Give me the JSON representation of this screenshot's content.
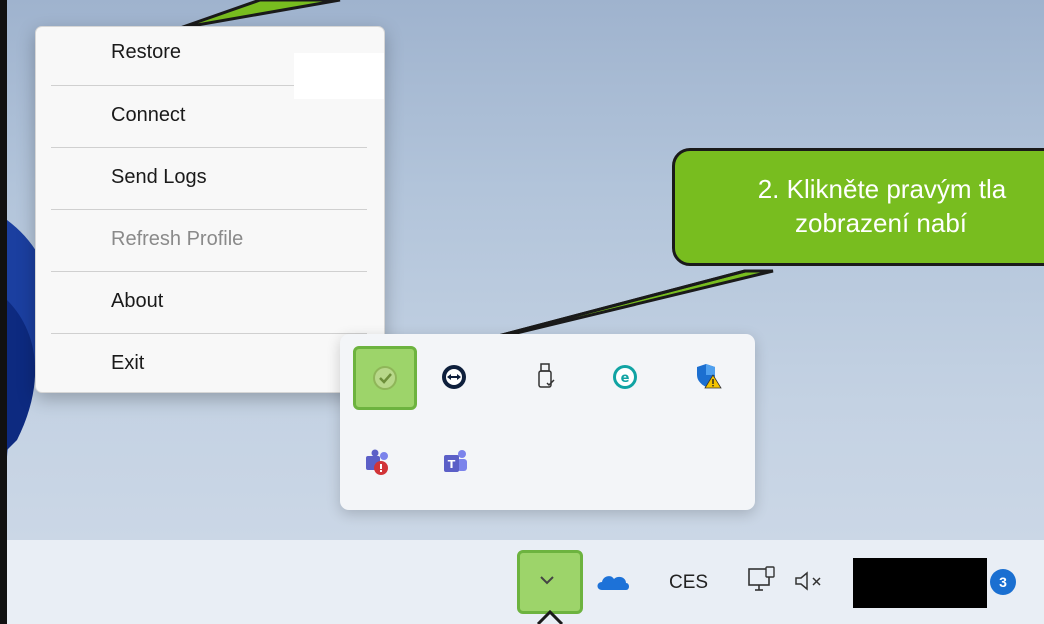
{
  "context_menu": {
    "items": [
      {
        "label": "Restore",
        "disabled": false
      },
      {
        "label": "Connect",
        "disabled": false
      },
      {
        "label": "Send Logs",
        "disabled": false
      },
      {
        "label": "Refresh Profile",
        "disabled": true
      },
      {
        "label": "About",
        "disabled": false
      },
      {
        "label": "Exit",
        "disabled": false
      }
    ]
  },
  "callout": {
    "line1": "2. Klikněte pravým tla",
    "line2": "zobrazení nabí"
  },
  "tray_flyout": {
    "icons": [
      {
        "name": "vpn-client-icon",
        "highlighted": true
      },
      {
        "name": "teamviewer-icon"
      },
      {
        "name": "usb-device-icon"
      },
      {
        "name": "eset-icon"
      },
      {
        "name": "windows-security-warning-icon"
      },
      {
        "name": "teams-notification-icon"
      },
      {
        "name": "teams-icon"
      }
    ]
  },
  "taskbar": {
    "language": "CES",
    "notification_count": "3",
    "icons": [
      "chevron-up-icon",
      "onedrive-cloud-icon",
      "network-icon",
      "volume-muted-icon"
    ]
  },
  "colors": {
    "callout_green": "#78bd1f",
    "highlight_green": "#9dd46a",
    "badge_blue": "#1a6fd1"
  }
}
